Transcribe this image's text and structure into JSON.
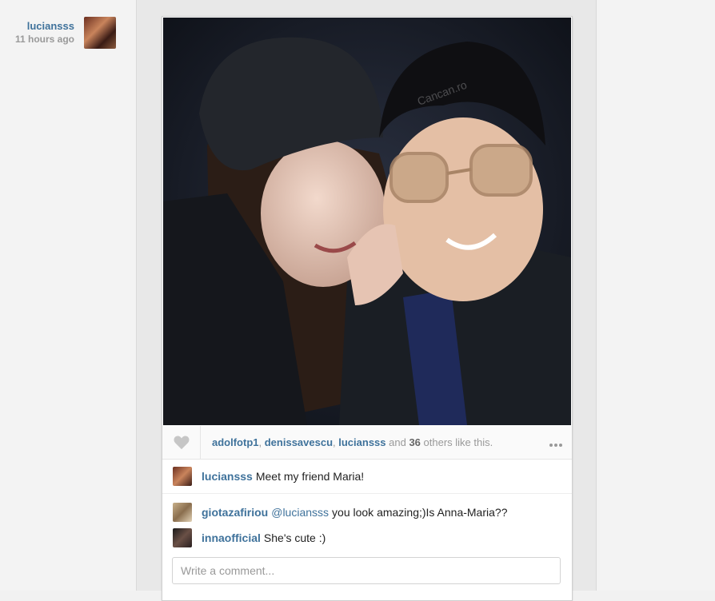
{
  "author": {
    "username": "luciansss",
    "time": "11 hours ago"
  },
  "likes": {
    "users": [
      "adolfotp1",
      "denissavescu",
      "luciansss"
    ],
    "separator": ", ",
    "and_text": " and ",
    "count": "36",
    "suffix": " others like this."
  },
  "caption": {
    "username": "luciansss",
    "text": "Meet my friend Maria!"
  },
  "comments": [
    {
      "username": "giotazafiriou",
      "mention": "@luciansss",
      "text": "you look amazing;)Is Anna-Maria??"
    },
    {
      "username": "innaofficial",
      "mention": "",
      "text": "She's cute :)"
    }
  ],
  "comment_input": {
    "placeholder": "Write a comment..."
  },
  "photo_watermark": "Cancan.ro",
  "icons": {
    "like": "heart-icon",
    "more": "more-options-icon"
  },
  "colors": {
    "link": "#3f729b",
    "muted": "#999999"
  }
}
